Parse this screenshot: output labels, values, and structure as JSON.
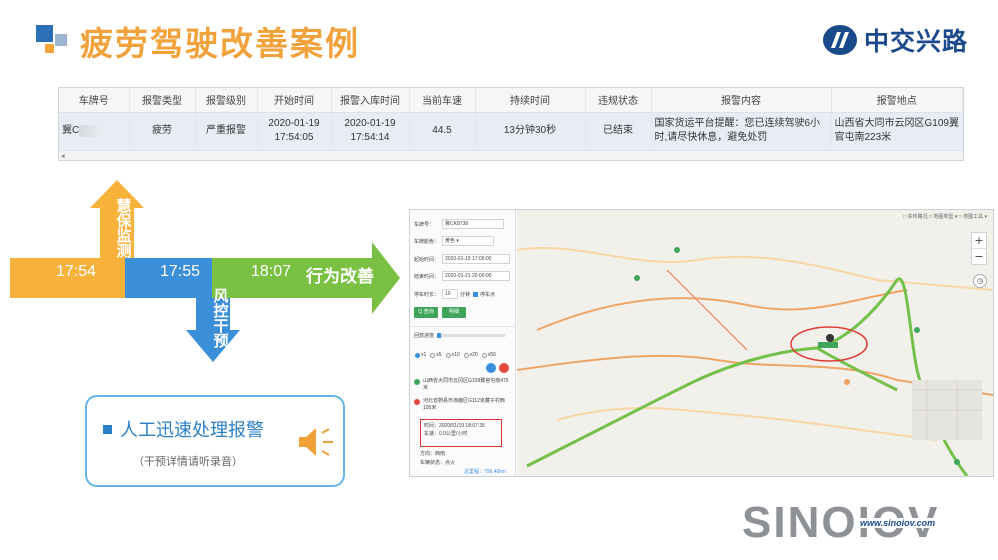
{
  "header": {
    "title": "疲劳驾驶改善案例",
    "brand_name": "中交兴路",
    "colors": {
      "title": "#f2a23b",
      "brand": "#1b4a8c"
    }
  },
  "alarm_table": {
    "columns": [
      "车牌号",
      "报警类型",
      "报警级别",
      "开始时间",
      "报警入库时间",
      "当前车速",
      "持续时间",
      "违规状态",
      "报警内容",
      "报警地点"
    ],
    "row": {
      "plate": "冀C",
      "type": "疲劳",
      "level": "严重报警",
      "start_time_date": "2020-01-19",
      "start_time_clock": "17:54:05",
      "store_time_date": "2020-01-19",
      "store_time_clock": "17:54:14",
      "speed": "44.5",
      "duration": "13分钟30秒",
      "status": "已结束",
      "content": "国家货运平台提醒：您已连续驾驶6小时,请尽快休息，避免处罚",
      "location": "山西省大同市云冈区G109翼官屯南223米"
    },
    "scroll_marker": "◂"
  },
  "flow": {
    "t_monitor": "17:54",
    "t_control": "17:55",
    "t_behavior": "18:07",
    "behavior_label": "行为改善",
    "monitor_label": [
      "慧",
      "保",
      "监",
      "测"
    ],
    "control_label": [
      "风",
      "控",
      "干",
      "预"
    ],
    "colors": {
      "monitor": "#f7b23b",
      "control": "#3b8fd9",
      "behavior": "#7ac143"
    }
  },
  "manual": {
    "title": "人工迅速处理报警",
    "note": "（干预详情请听录音）",
    "icon": "speaker-icon"
  },
  "map_panel": {
    "sidebar": {
      "plate_label": "车牌号：",
      "plate_value": "冀CK8738",
      "color_label": "车牌颜色：",
      "color_value": "黄色",
      "start_label": "起始时间：",
      "start_value": "2020-01-19 17:00:00",
      "end_label": "结束时间：",
      "end_value": "2020-01-21 20:00:00",
      "stop_label": "停车时长：",
      "stop_value": "10",
      "stop_unit": "分钟",
      "stop_point_label": "停车点",
      "search_btn": "Q 查询",
      "clear_btn": "明细",
      "progress_label": "回放进度",
      "speeds": [
        "x1",
        "x5",
        "x10",
        "x20",
        "x50"
      ],
      "event1": "山西省大同市云冈区G109翼官屯南475米",
      "event2": "河北省蔚县市涿鹿区G112京藏子村西105米",
      "detail_time": "时间：2020/01/19 18:07:35",
      "detail_speed": "车速：0.0公里/小时",
      "direction": "方向：西南",
      "vehicle_status": "车辆状态：点火",
      "total_mileage": "总里程：799.40km"
    },
    "map_tools": "□ 实时路况  □ 地图类型 ▾  □ 地图工具 ▾",
    "zoom_in": "+",
    "zoom_out": "−"
  },
  "footer": {
    "brand": "SINOIOV",
    "url": "www.sinoiov.com"
  }
}
